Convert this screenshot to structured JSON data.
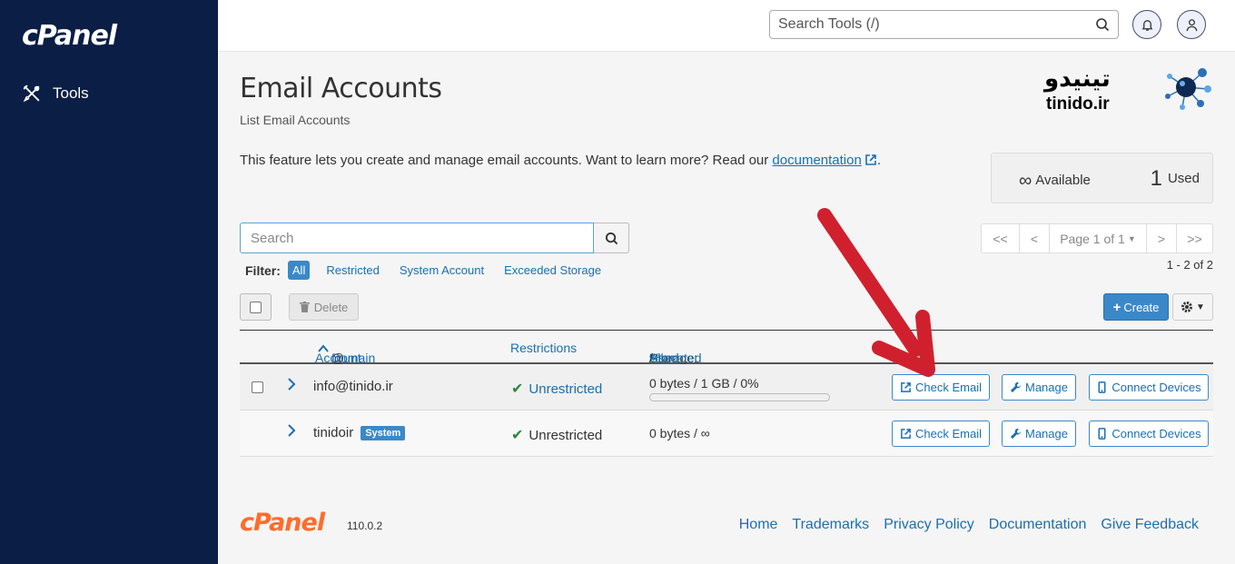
{
  "sidebar": {
    "logo": "cPanel",
    "nav": [
      {
        "label": "Tools"
      }
    ]
  },
  "topbar": {
    "search_placeholder": "Search Tools (/)"
  },
  "brand": {
    "name_fa": "تینیدو",
    "name_en": "tinido.ir"
  },
  "page": {
    "title": "Email Accounts",
    "subtitle": "List Email Accounts",
    "intro_text": "This feature lets you create and manage email accounts. Want to learn more? Read our ",
    "intro_link": "documentation",
    "intro_end": "."
  },
  "quota": {
    "available_symbol": "∞",
    "available_label": "Available",
    "used_count": "1",
    "used_label": "Used"
  },
  "list": {
    "search_placeholder": "Search",
    "filter_label": "Filter:",
    "filters": [
      "All",
      "Restricted",
      "System Account",
      "Exceeded Storage"
    ],
    "active_filter": "All",
    "delete_label": "Delete",
    "create_label": "Create",
    "pager": {
      "first": "<<",
      "prev": "<",
      "page": "Page 1 of 1",
      "next": ">",
      "last": ">>"
    },
    "range": "1 - 2 of 2"
  },
  "table": {
    "headers": {
      "account": "Account",
      "at": "@",
      "domain": "Domain",
      "restrictions": "Restrictions",
      "storage_prefix": "Storage:",
      "used": "Used",
      "sep1": "/",
      "allocated": "Allocated",
      "sep2": "/",
      "percent": "%"
    },
    "rows": [
      {
        "account": "info@tinido.ir",
        "badge": "",
        "restriction": "Unrestricted",
        "storage": "0 bytes / 1 GB / 0%",
        "usage_fraction": 0
      },
      {
        "account": "tinidoir",
        "badge": "System",
        "restriction": "Unrestricted",
        "storage": "0 bytes / ∞"
      }
    ],
    "actions": {
      "check_email": "Check Email",
      "manage": "Manage",
      "connect": "Connect Devices"
    }
  },
  "footer": {
    "logo": "cPanel",
    "version": "110.0.2",
    "links": [
      "Home",
      "Trademarks",
      "Privacy Policy",
      "Documentation",
      "Give Feedback"
    ]
  },
  "colors": {
    "sidebar_bg": "#0a1e46",
    "accent": "#3b88c9",
    "link": "#1a6fb3",
    "annotation_arrow": "#d0202e",
    "footer_logo": "#ff6c2c"
  }
}
